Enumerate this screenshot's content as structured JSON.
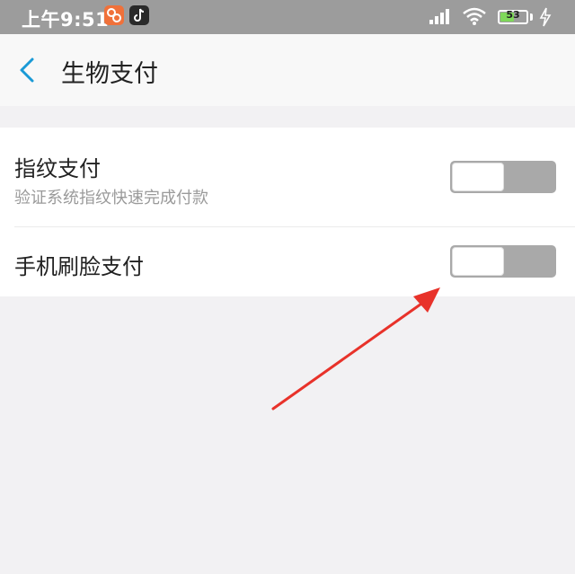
{
  "status_bar": {
    "time": "上午9:51",
    "battery_level": "53",
    "battery_fraction": 0.53,
    "icons": [
      "app-badge-orange",
      "tiktok-icon",
      "signal-icon",
      "wifi-icon",
      "battery-icon",
      "charging-icon"
    ]
  },
  "header": {
    "back_icon": "chevron-left-icon",
    "title": "生物支付"
  },
  "settings": [
    {
      "title": "指纹支付",
      "subtitle": "验证系统指纹快速完成付款",
      "enabled": false
    },
    {
      "title": "手机刷脸支付",
      "enabled": false
    }
  ],
  "colors": {
    "accent": "#1a9ad6",
    "toggle_off": "#a9a9a9",
    "annotation_arrow": "#e8322a"
  }
}
